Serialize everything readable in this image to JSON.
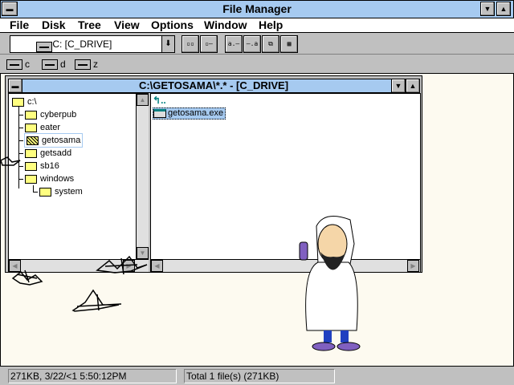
{
  "title": "File Manager",
  "menu": [
    "File",
    "Disk",
    "Tree",
    "View",
    "Options",
    "Window",
    "Help"
  ],
  "toolbar": {
    "drive_combo": "C: [C_DRIVE]",
    "buttons": [
      "by-name-icons",
      "all-file-details",
      "sort-by-name",
      "sort-by-type",
      "connect-network-drive",
      "disconnect-network-drive"
    ]
  },
  "drives": [
    "c",
    "d",
    "z"
  ],
  "child": {
    "title": "C:\\GETOSAMA\\*.* - [C_DRIVE]",
    "tree": [
      {
        "label": "c:\\",
        "level": 0
      },
      {
        "label": "cyberpub",
        "level": 1
      },
      {
        "label": "eater",
        "level": 1
      },
      {
        "label": "getosama",
        "level": 1,
        "selected": true
      },
      {
        "label": "getsadd",
        "level": 1
      },
      {
        "label": "sb16",
        "level": 1
      },
      {
        "label": "windows",
        "level": 1
      },
      {
        "label": "system",
        "level": 2
      }
    ],
    "files": {
      "up": "..",
      "items": [
        "getosama.exe"
      ]
    }
  },
  "status": {
    "left": "271KB, 3/22/<1 5:50:12PM",
    "right": "Total 1 file(s) (271KB)"
  },
  "colors": {
    "titlebar": "#a6caf0",
    "desktop": "#fdfaf0",
    "folder": "#ffff80"
  }
}
